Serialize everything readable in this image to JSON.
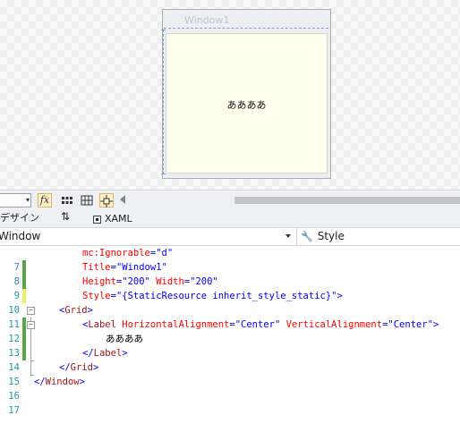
{
  "designer": {
    "window_title": "Window1",
    "label_content": "ああああ"
  },
  "toolbar": {
    "zoom_value": "",
    "buttons": [
      {
        "name": "formula-fx",
        "label": "fx",
        "active": true
      },
      {
        "name": "grid",
        "label": "",
        "active": false
      },
      {
        "name": "snap-to-grid",
        "label": "",
        "active": false
      },
      {
        "name": "snaplines",
        "label": "",
        "active": true
      }
    ]
  },
  "tabs": {
    "design": "デザイン",
    "swap": "⇅",
    "xaml": "XAML"
  },
  "nav": {
    "element": "Window",
    "member": "Style"
  },
  "editor": {
    "lines": [
      {
        "num": "7"
      },
      {
        "num": "8"
      },
      {
        "num": "9"
      },
      {
        "num": "10"
      },
      {
        "num": "11"
      },
      {
        "num": "12"
      },
      {
        "num": "13"
      },
      {
        "num": "14"
      },
      {
        "num": "15"
      },
      {
        "num": "16"
      },
      {
        "num": "17"
      }
    ],
    "code": {
      "l7_name": "mc:Ignorable",
      "l7_val": "\"d\"",
      "l8_name": "Title",
      "l8_val": "\"Window1\"",
      "l9_name1": "Height",
      "l9_val1": "\"200\"",
      "l9_name2": "Width",
      "l9_val2": "\"200\"",
      "l10_name": "Style",
      "l10_val": "\"{StaticResource inherit_style_static}\"",
      "l10_close": ">",
      "l11_open": "<",
      "l11_tag": "Grid",
      "l11_close": ">",
      "l12_open": "<",
      "l12_tag": "Label",
      "l12_name1": "HorizontalAlignment",
      "l12_val1": "\"Center\"",
      "l12_name2": "VerticalAlignment",
      "l12_val2": "\"Center\"",
      "l12_close": ">",
      "l13_text": "ああああ",
      "l14_open": "</",
      "l14_tag": "Label",
      "l14_close": ">",
      "l15_open": "</",
      "l15_tag": "Grid",
      "l15_close": ">",
      "l16_open": "</",
      "l16_tag": "Window",
      "l16_close": ">",
      "eq": "="
    }
  }
}
